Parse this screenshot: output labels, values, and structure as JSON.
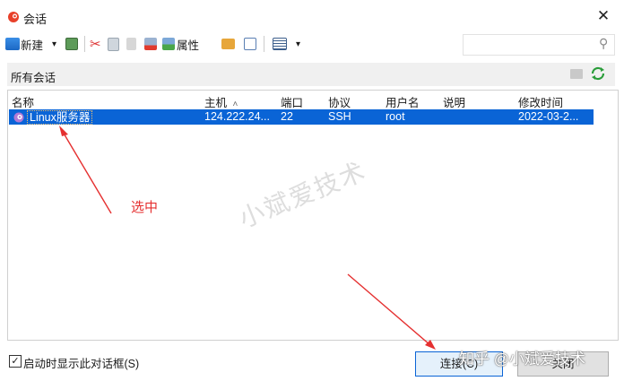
{
  "window": {
    "title": "会话",
    "close_glyph": "✕"
  },
  "toolbar": {
    "new_label": "新建",
    "properties_label": "属性",
    "new_dropdown_glyph": "▾",
    "view_dropdown_glyph": "▾",
    "search_placeholder": "",
    "search_icon_glyph": "⚲"
  },
  "pathbar": {
    "label": "所有会话"
  },
  "table": {
    "headers": [
      "名称",
      "主机",
      "端口",
      "协议",
      "用户名",
      "说明",
      "修改时间"
    ],
    "sort_indicator": "˄",
    "rows": [
      {
        "name": "Linux服务器",
        "host": "124.222.24...",
        "port": "22",
        "protocol": "SSH",
        "user": "root",
        "description": "",
        "modified": "2022-03-2..."
      }
    ]
  },
  "annotation": {
    "label": "选中",
    "color": "#e53030"
  },
  "watermarks": {
    "center": "小斌爱技术",
    "footer": "知乎 @小斌爱技术"
  },
  "footer": {
    "checkbox_checked": true,
    "checkbox_glyph": "✓",
    "checkbox_label": "启动时显示此对话框(S)",
    "connect_label": "连接(C)",
    "close_label": "关闭"
  },
  "colors": {
    "selection": "#0a64d6",
    "accent_green": "#2a9d3a",
    "arrow": "#e53030"
  }
}
